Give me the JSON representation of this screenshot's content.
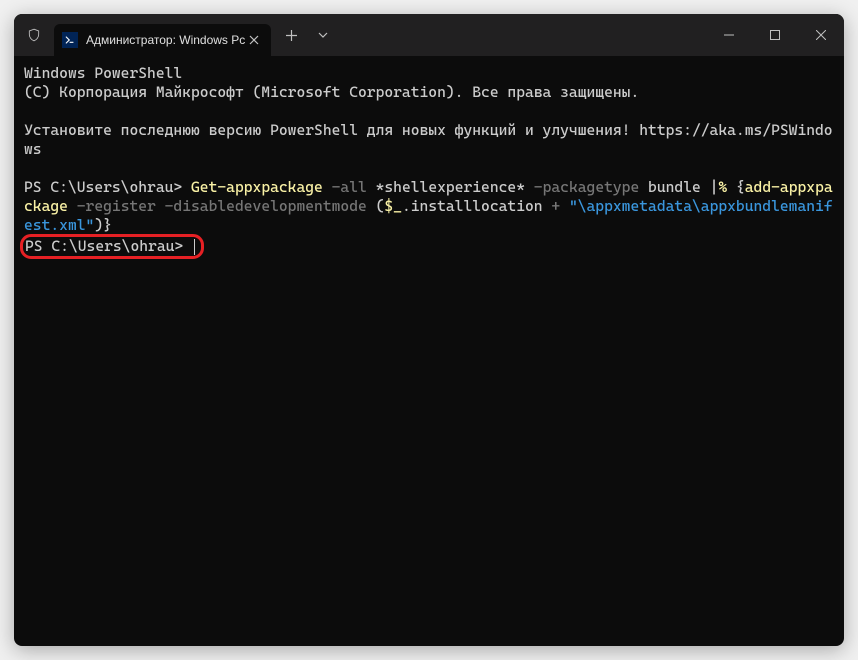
{
  "tab": {
    "title": "Администратор: Windows Pc"
  },
  "terminal": {
    "header_line1": "Windows PowerShell",
    "header_line2": "(C) Корпорация Майкрософт (Microsoft Corporation). Все права защищены.",
    "info_line": "Установите последнюю версию PowerShell для новых функций и улучшения! https://aka.ms/PSWindows",
    "prompt1": "PS C:\\Users\\ohrau> ",
    "cmd": {
      "part1": "Get-appxpackage",
      "part2": " -all",
      "part3": " *shellexperience*",
      "part4": " -packagetype",
      "part5": " bundle ",
      "part6": "|",
      "part7": "% ",
      "part8": "{",
      "part9": "add-appxpackage",
      "part10": " -register -disabledevelopmentmode",
      "part11": " (",
      "part12": "$_",
      "part13": ".installlocation ",
      "part14": "+ ",
      "part15": "\"\\appxmetadata\\appxbundlemanifest.xml\"",
      "part16": ")}"
    },
    "prompt2": "PS C:\\Users\\ohrau> "
  }
}
